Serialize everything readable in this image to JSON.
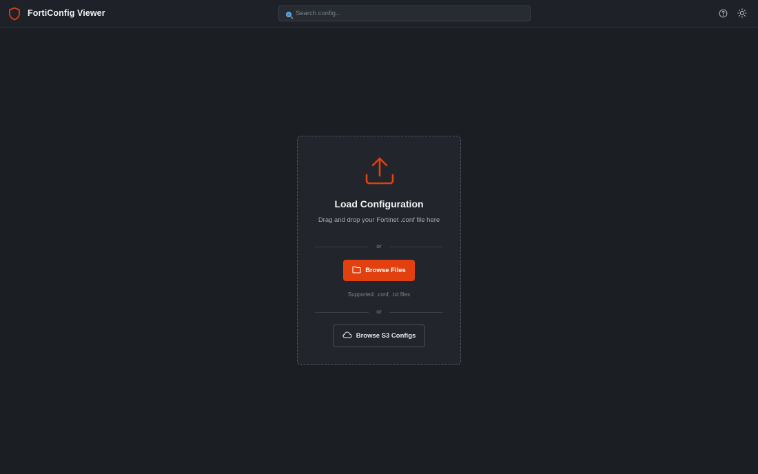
{
  "header": {
    "app_title": "FortiConfig Viewer",
    "search_placeholder": "Search config...",
    "search_value": "",
    "logo_icon": "shield-icon",
    "help_icon": "help-circle-icon",
    "theme_icon": "sun-icon"
  },
  "upload_card": {
    "icon": "upload-icon",
    "title": "Load Configuration",
    "subtitle": "Drag and drop your Fortinet .conf file here",
    "divider_text_1": "or",
    "browse_files_label": "Browse Files",
    "browse_files_icon": "folder-icon",
    "supported_text": "Supported: .conf, .txt files",
    "divider_text_2": "or",
    "browse_s3_label": "Browse S3 Configs",
    "browse_s3_icon": "cloud-icon"
  },
  "colors": {
    "accent": "#e2410f",
    "background": "#1b1e23",
    "card_background": "#22262c",
    "header_background": "#1e2127"
  }
}
